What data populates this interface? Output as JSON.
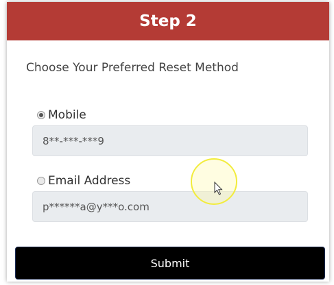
{
  "header": {
    "title": "Step 2"
  },
  "prompt": "Choose Your Preferred Reset Method",
  "options": [
    {
      "label": "Mobile",
      "value": "8**-***-***9",
      "selected": true
    },
    {
      "label": "Email Address",
      "value": "p******a@y***o.com",
      "selected": false
    }
  ],
  "submit_label": "Submit",
  "colors": {
    "header_bg": "#b43b35",
    "button_bg": "#000000",
    "field_bg": "#e9ecef"
  },
  "cursor": {
    "icon": "pointer-arrow-icon"
  }
}
